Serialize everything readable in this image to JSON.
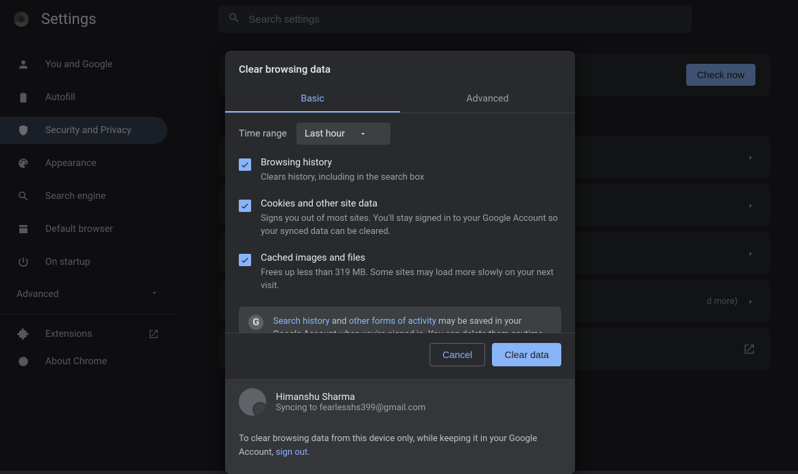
{
  "header": {
    "title": "Settings",
    "search_placeholder": "Search settings"
  },
  "sidebar": {
    "items": [
      {
        "label": "You and Google"
      },
      {
        "label": "Autofill"
      },
      {
        "label": "Security and Privacy"
      },
      {
        "label": "Appearance"
      },
      {
        "label": "Search engine"
      },
      {
        "label": "Default browser"
      },
      {
        "label": "On startup"
      }
    ],
    "advanced": "Advanced",
    "extensions": "Extensions",
    "about": "About Chrome"
  },
  "content": {
    "check_now": "Check now",
    "more_hint": "d more)"
  },
  "dialog": {
    "title": "Clear browsing data",
    "tabs": {
      "basic": "Basic",
      "advanced": "Advanced"
    },
    "time_label": "Time range",
    "time_value": "Last hour",
    "checks": [
      {
        "title": "Browsing history",
        "desc": "Clears history, including in the search box"
      },
      {
        "title": "Cookies and other site data",
        "desc": "Signs you out of most sites. You'll stay signed in to your Google Account so your synced data can be cleared."
      },
      {
        "title": "Cached images and files",
        "desc": "Frees up less than 319 MB. Some sites may load more slowly on your next visit."
      }
    ],
    "info_links": {
      "search_history": "Search history",
      "other_forms": "other forms of activity"
    },
    "info_text_1": " and ",
    "info_text_2": " may be saved in your Google Account when you're signed in. You can delete them anytime.",
    "cancel": "Cancel",
    "clear": "Clear data",
    "account": {
      "name": "Himanshu Sharma",
      "sync": "Syncing to fearlesshs399@gmail.com"
    },
    "footer_text": "To clear browsing data from this device only, while keeping it in your Google Account, ",
    "sign_out": "sign out",
    "period": "."
  }
}
